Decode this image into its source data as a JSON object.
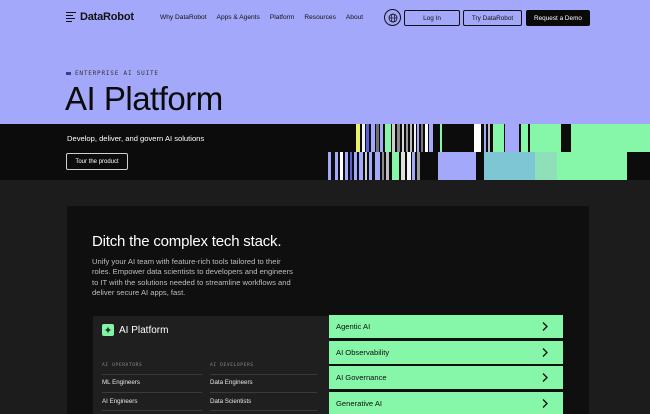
{
  "nav": {
    "logo": "DataRobot",
    "links": [
      "Why DataRobot",
      "Apps & Agents",
      "Platform",
      "Resources",
      "About"
    ],
    "login": "Log In",
    "try": "Try DataRobot",
    "demo": "Request a Demo"
  },
  "hero": {
    "eyebrow": "ENTERPRISE AI SUITE",
    "title": "AI Platform",
    "subtitle": "Develop, deliver, and govern AI solutions",
    "tour": "Tour the product"
  },
  "section": {
    "title": "Ditch the complex tech stack.",
    "description": "Unify your AI team with feature-rich tools tailored to their roles. Empower data scientists to developers and engineers to IT with the solutions needed to streamline workflows and deliver secure AI apps, fast.",
    "card": {
      "title": "AI Platform",
      "col1_header": "AI OPERATORS",
      "col2_header": "AI DEVELOPERS",
      "col1_items": [
        "ML Engineers",
        "AI Engineers"
      ],
      "col2_items": [
        "Data Engineers",
        "Data Scientists"
      ]
    },
    "list": [
      "Agentic AI",
      "AI Observability",
      "AI Governance",
      "Generative AI"
    ]
  },
  "colors": {
    "hero_bg": "#a4a8fa",
    "accent_green": "#86f7a8",
    "dark_bg": "#1c1c1c"
  },
  "icons": [
    "datarobot-logo-icon",
    "globe-icon",
    "ai-platform-icon",
    "chevron-right-icon"
  ]
}
